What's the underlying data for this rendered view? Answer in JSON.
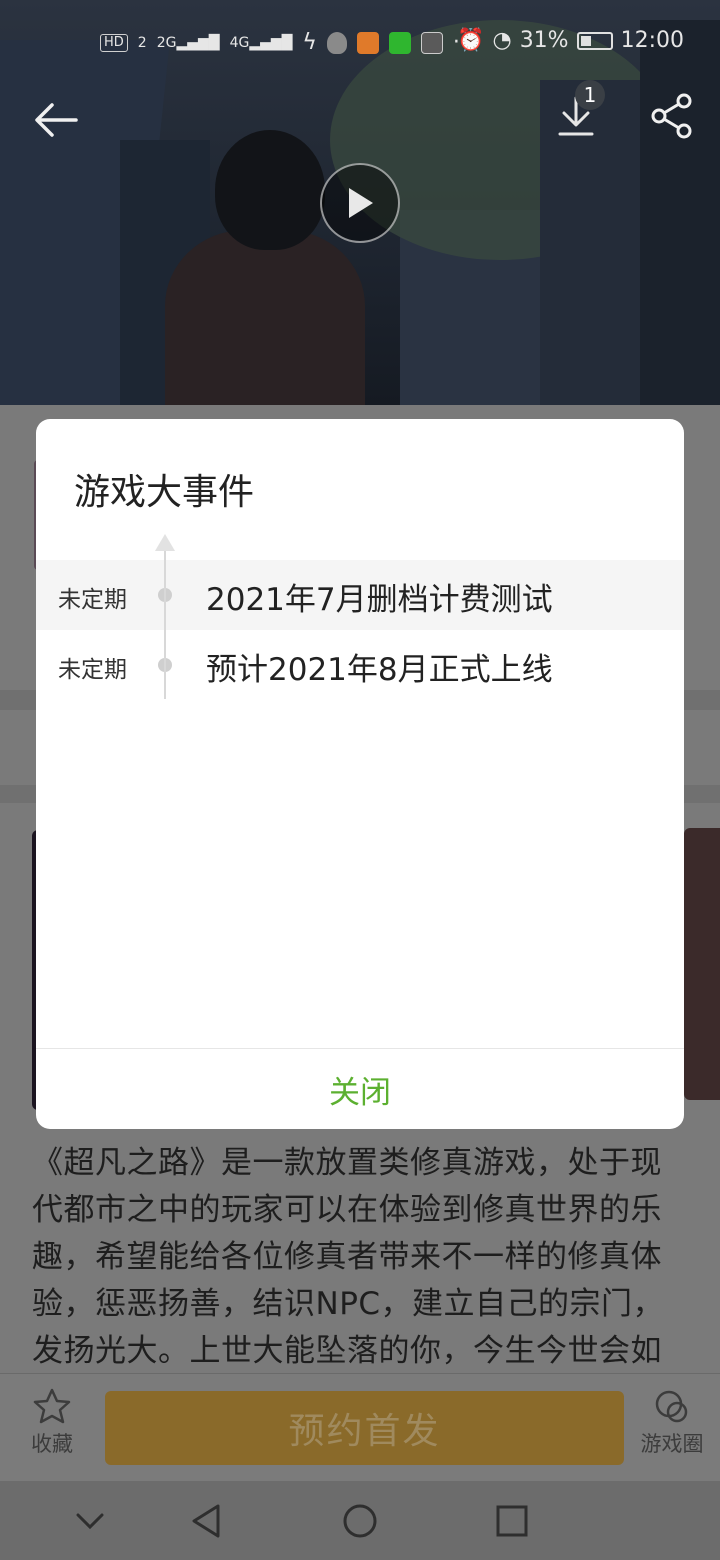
{
  "status_bar": {
    "left_indicators": [
      "HD",
      "2",
      "2G",
      "4G"
    ],
    "battery_percent": "31%",
    "time": "12:00",
    "more": "···"
  },
  "header": {
    "download_count": "1"
  },
  "dialog": {
    "title": "游戏大事件",
    "events": [
      {
        "date": "未定期",
        "text": "2021年7月删档计费测试"
      },
      {
        "date": "未定期",
        "text": "预计2021年8月正式上线"
      }
    ],
    "close_label": "关闭"
  },
  "description": {
    "lines": [
      "《超凡之路》是一款放置类修真游戏，处于现",
      "代都市之中的玩家可以在体验到修真世界的乐",
      "趣，希望能给各位修真者带来不一样的修真体",
      "验，惩恶扬善，结识NPC，建立自己的宗门，",
      "发扬光大。上世大能坠落的你，今生今世会如"
    ]
  },
  "bottom_bar": {
    "favorite_label": "收藏",
    "reserve_label": "预约首发",
    "circle_label": "游戏圈"
  },
  "colors": {
    "accent_green": "#5cb030",
    "reserve_button": "#8a6a2a"
  }
}
